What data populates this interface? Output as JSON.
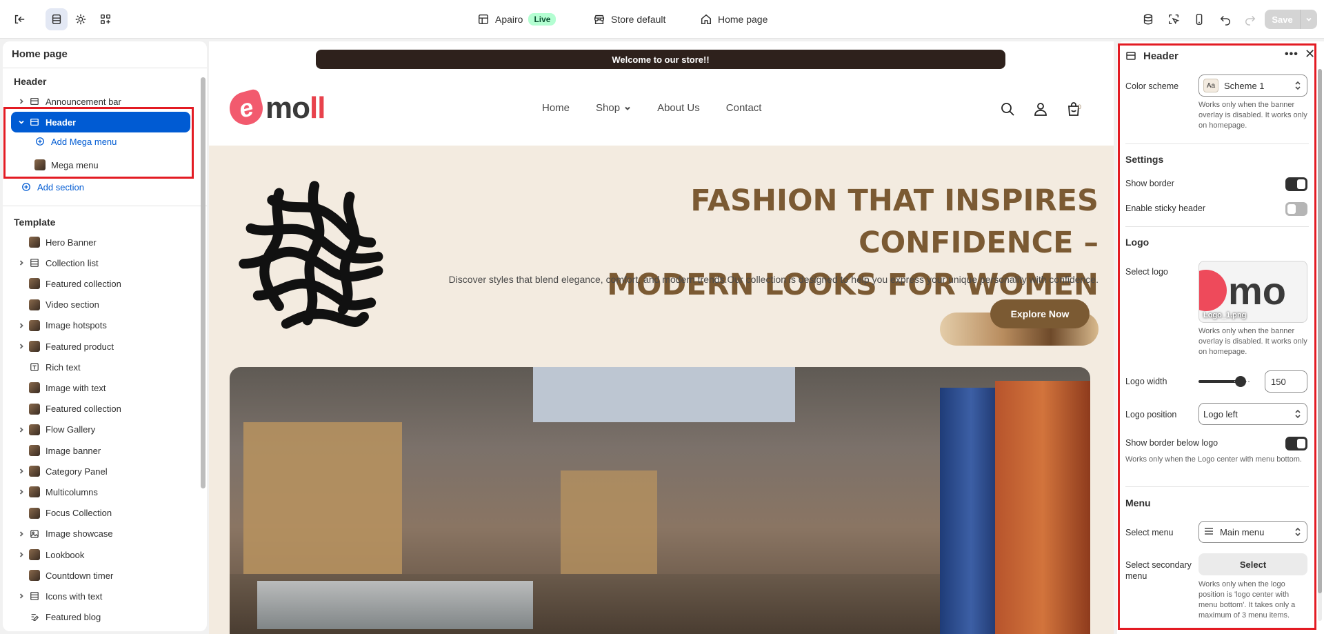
{
  "topbar": {
    "store_name": "Apairo",
    "live_badge": "Live",
    "store_default": "Store default",
    "page": "Home page",
    "save_label": "Save"
  },
  "left_panel": {
    "title": "Home page",
    "header_group": "Header",
    "header_items": [
      {
        "label": "Announcement bar",
        "icon": "section-icon"
      },
      {
        "label": "Header",
        "icon": "section-icon"
      },
      {
        "label": "Add Mega menu",
        "icon": "add-circle-icon"
      },
      {
        "label": "Mega menu",
        "icon": "image-thumb"
      },
      {
        "label": "Add section",
        "icon": "add-circle-icon"
      }
    ],
    "template_group": "Template",
    "template_items": [
      {
        "label": "Hero Banner"
      },
      {
        "label": "Collection list"
      },
      {
        "label": "Featured collection"
      },
      {
        "label": "Video section"
      },
      {
        "label": "Image hotspots"
      },
      {
        "label": "Featured product"
      },
      {
        "label": "Rich text"
      },
      {
        "label": "Image with text"
      },
      {
        "label": "Featured collection"
      },
      {
        "label": "Flow Gallery"
      },
      {
        "label": "Image banner"
      },
      {
        "label": "Category Panel"
      },
      {
        "label": "Multicolumns"
      },
      {
        "label": "Focus Collection"
      },
      {
        "label": "Image showcase"
      },
      {
        "label": "Lookbook"
      },
      {
        "label": "Countdown timer"
      },
      {
        "label": "Icons with text"
      },
      {
        "label": "Featured blog"
      }
    ]
  },
  "preview": {
    "announcement": "Welcome to our store!!",
    "logo_letter": "e",
    "logo_text_main": "mo",
    "logo_text_accent": "ll",
    "nav": [
      "Home",
      "Shop",
      "About Us",
      "Contact"
    ],
    "cart_count": "0",
    "hero_title_line1": "FASHION THAT INSPIRES CONFIDENCE –",
    "hero_title_line2": "MODERN LOOKS FOR WOMEN",
    "hero_desc": "Discover styles that blend elegance, comfort, and modern trends.Our collection is designed to help you express your unique personality with confidence.",
    "explore_label": "Explore Now"
  },
  "right_panel": {
    "title": "Header",
    "color_scheme_label": "Color scheme",
    "color_scheme_value": "Scheme 1",
    "color_scheme_swatch": "Aa",
    "color_scheme_help": "Works only when the banner overlay is disabled. It works only on homepage.",
    "settings_heading": "Settings",
    "show_border_label": "Show border",
    "sticky_label": "Enable sticky header",
    "logo_heading": "Logo",
    "select_logo_label": "Select logo",
    "logo_file": "Logo_1.png",
    "logo_help": "Works only when the banner overlay is disabled. It works only on homepage.",
    "logo_width_label": "Logo width",
    "logo_width_value": "150",
    "logo_position_label": "Logo position",
    "logo_position_value": "Logo left",
    "border_below_logo_label": "Show border below logo",
    "border_below_help": "Works only when the Logo center with menu bottom.",
    "menu_heading": "Menu",
    "select_menu_label": "Select menu",
    "select_menu_value": "Main menu",
    "secondary_menu_label": "Select secondary menu",
    "select_button": "Select",
    "secondary_help": "Works only when the logo position is 'logo center with menu bottom'. It takes only a maximum of 3 menu items."
  },
  "colors": {
    "accent": "#005bd3",
    "highlight_box": "#e31b23",
    "brand_brown": "#7b5a33",
    "live_green": "#b4fed2"
  }
}
